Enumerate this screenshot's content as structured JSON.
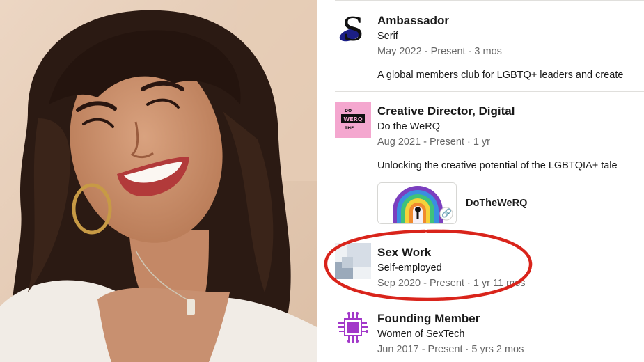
{
  "experience": [
    {
      "title": "Ambassador",
      "company": "Serif",
      "dates": "May 2022 - Present · 3 mos",
      "description": "A global members club for LGBTQ+ leaders and create",
      "logo_icon": "serif-s-logo"
    },
    {
      "title": "Creative Director, Digital",
      "company": "Do the WeRQ",
      "dates": "Aug 2021 - Present · 1 yr",
      "description": "Unlocking the creative potential of the LGBTQIA+ tale",
      "logo_icon": "do-the-werq-logo",
      "logo_text": "DO THE WERQ",
      "media": {
        "label": "DoTheWeRQ",
        "icon": "link-icon"
      }
    },
    {
      "title": "Sex Work",
      "company": "Self-employed",
      "dates": "Sep 2020 - Present · 1 yr 11 mos",
      "logo_icon": "placeholder-company-logo"
    },
    {
      "title": "Founding Member",
      "company": "Women of SexTech",
      "dates": "Jun 2017 - Present · 5 yrs 2 mos",
      "logo_icon": "women-of-sextech-logo"
    }
  ],
  "colors": {
    "highlight": "#d9241b",
    "secondary_text": "#666666",
    "divider": "#e0dfdc",
    "werq_pink": "#f4a7cf",
    "sextech_purple": "#a238c9"
  }
}
